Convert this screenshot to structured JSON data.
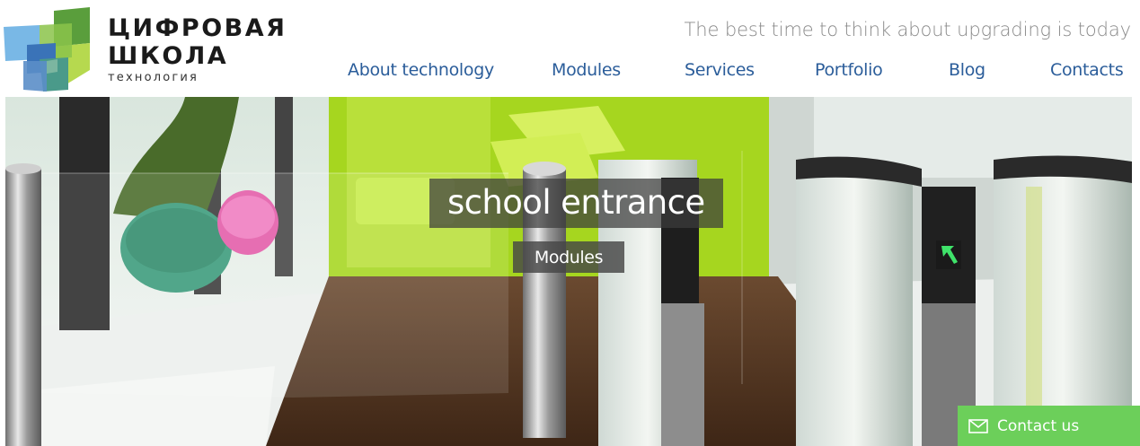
{
  "brand": {
    "line1": "ЦИФРОВАЯ",
    "line2": "ШКОЛА",
    "line3": "технология",
    "colors": {
      "blue_light": "#79b8e6",
      "blue_dark": "#3a73b8",
      "green_light": "#b6d94f",
      "green_dark": "#5a9e3c",
      "teal": "#4a9a8a"
    }
  },
  "header": {
    "tagline": "The best time to think about upgrading is today",
    "nav": [
      {
        "label": "About technology"
      },
      {
        "label": "Modules"
      },
      {
        "label": "Services"
      },
      {
        "label": "Portfolio"
      },
      {
        "label": "Blog"
      },
      {
        "label": "Contacts"
      }
    ],
    "accent_color": "#2b5d9a"
  },
  "hero": {
    "title": "school entrance",
    "button_label": "Modules"
  },
  "contact_widget": {
    "label": "Contact us",
    "icon": "envelope-icon",
    "color": "#6ccf5a"
  }
}
